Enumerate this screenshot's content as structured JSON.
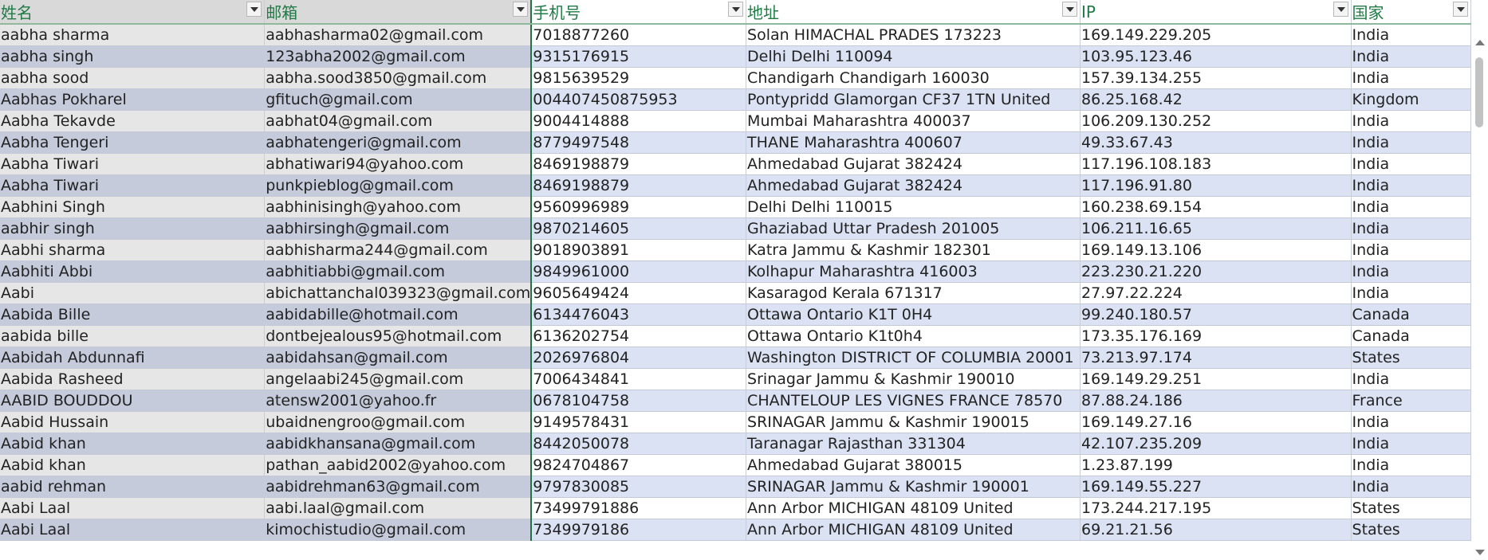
{
  "columns": [
    {
      "label": "姓名"
    },
    {
      "label": "邮箱"
    },
    {
      "label": "手机号"
    },
    {
      "label": "地址"
    },
    {
      "label": "IP"
    },
    {
      "label": "国家"
    }
  ],
  "rows": [
    [
      "aabha sharma",
      "aabhasharma02@gmail.com",
      "7018877260",
      "Solan HIMACHAL PRADES 173223",
      "169.149.229.205",
      "India"
    ],
    [
      "aabha singh",
      "123abha2002@gmail.com",
      "9315176915",
      "Delhi Delhi 110094",
      "103.95.123.46",
      "India"
    ],
    [
      "aabha sood",
      "aabha.sood3850@gmail.com",
      "9815639529",
      "Chandigarh Chandigarh 160030",
      "157.39.134.255",
      "India"
    ],
    [
      "Aabhas Pokharel",
      "gfituch@gmail.com",
      "004407450875953",
      "Pontypridd Glamorgan CF37 1TN United",
      "86.25.168.42",
      "Kingdom"
    ],
    [
      "Aabha Tekavde",
      "aabhat04@gmail.com",
      "9004414888",
      "Mumbai Maharashtra 400037",
      "106.209.130.252",
      "India"
    ],
    [
      "Aabha Tengeri",
      "aabhatengeri@gmail.com",
      "8779497548",
      "THANE Maharashtra 400607",
      "49.33.67.43",
      "India"
    ],
    [
      "Aabha Tiwari",
      "abhatiwari94@yahoo.com",
      "8469198879",
      "Ahmedabad Gujarat 382424",
      "117.196.108.183",
      "India"
    ],
    [
      "Aabha Tiwari",
      "punkpieblog@gmail.com",
      "8469198879",
      "Ahmedabad Gujarat 382424",
      "117.196.91.80",
      "India"
    ],
    [
      "Aabhini Singh",
      "aabhinisingh@yahoo.com",
      "9560996989",
      "Delhi Delhi 110015",
      "160.238.69.154",
      "India"
    ],
    [
      "aabhir singh",
      "aabhirsingh@gmail.com",
      "9870214605",
      "Ghaziabad Uttar Pradesh 201005",
      "106.211.16.65",
      "India"
    ],
    [
      "Aabhi sharma",
      "aabhisharma244@gmail.com",
      "9018903891",
      "Katra Jammu & Kashmir 182301",
      "169.149.13.106",
      "India"
    ],
    [
      "Aabhiti Abbi",
      "aabhitiabbi@gmail.com",
      "9849961000",
      "Kolhapur Maharashtra 416003",
      "223.230.21.220",
      "India"
    ],
    [
      "Aabi",
      "abichattanchal039323@gmail.com",
      "9605649424",
      "Kasaragod Kerala 671317",
      "27.97.22.224",
      "India"
    ],
    [
      "Aabida Bille",
      "aabidabille@hotmail.com",
      "6134476043",
      "Ottawa Ontario K1T 0H4",
      "99.240.180.57",
      "Canada"
    ],
    [
      "aabida bille",
      "dontbejealous95@hotmail.com",
      "6136202754",
      "Ottawa Ontario K1t0h4",
      "173.35.176.169",
      "Canada"
    ],
    [
      "Aabidah Abdunnafi",
      "aabidahsan@gmail.com",
      "2026976804",
      "Washington DISTRICT OF COLUMBIA 20001",
      "73.213.97.174",
      "States"
    ],
    [
      "Aabida Rasheed",
      "angelaabi245@gmail.com",
      "7006434841",
      "Srinagar Jammu & Kashmir 190010",
      "169.149.29.251",
      "India"
    ],
    [
      "AABID BOUDDOU",
      "atensw2001@yahoo.fr",
      "0678104758",
      "CHANTELOUP LES VIGNES FRANCE 78570",
      "87.88.24.186",
      "France"
    ],
    [
      "Aabid Hussain",
      "ubaidnengroo@gmail.com",
      "9149578431",
      "SRINAGAR Jammu & Kashmir 190015",
      "169.149.27.16",
      "India"
    ],
    [
      "Aabid khan",
      "aabidkhansana@gmail.com",
      "8442050078",
      "Taranagar Rajasthan 331304",
      "42.107.235.209",
      "India"
    ],
    [
      "Aabid khan",
      "pathan_aabid2002@yahoo.com",
      "9824704867",
      "Ahmedabad Gujarat 380015",
      "1.23.87.199",
      "India"
    ],
    [
      "aabid rehman",
      "aabidrehman63@gmail.com",
      "9797830085",
      "SRINAGAR Jammu & Kashmir 190001",
      "169.149.55.227",
      "India"
    ],
    [
      "Aabi Laal",
      "aabi.laal@gmail.com",
      "73499791886",
      "Ann Arbor MICHIGAN 48109 United",
      "173.244.217.195",
      "States"
    ],
    [
      "Aabi Laal",
      "kimochistudio@gmail.com",
      "7349979186",
      "Ann Arbor MICHIGAN 48109 United",
      "69.21.21.56",
      "States"
    ]
  ],
  "theme": {
    "header_text_color": "#1f7a45",
    "band_color": "#dbe2f3",
    "selection_border": "#217346"
  },
  "icons": {
    "filter": "filter-dropdown-icon"
  }
}
